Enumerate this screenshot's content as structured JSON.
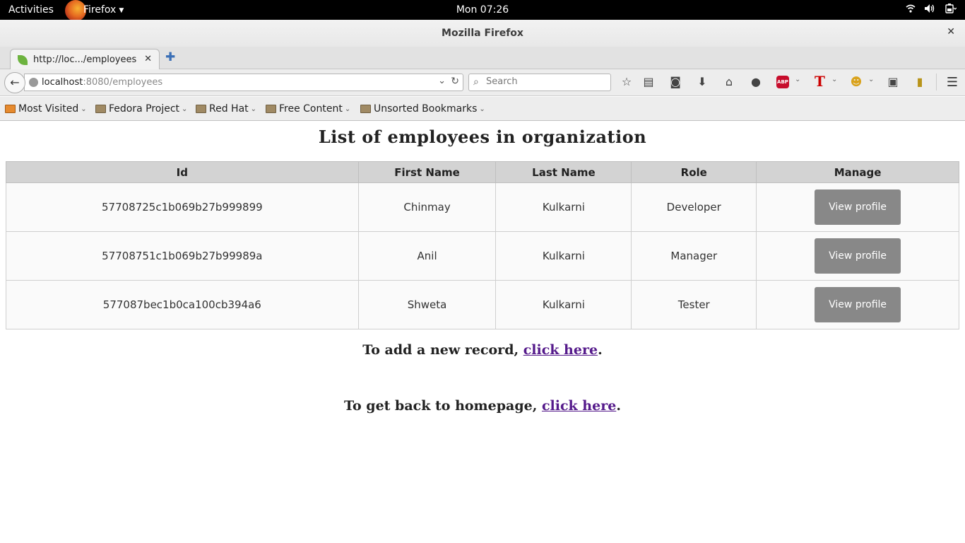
{
  "topbar": {
    "activities": "Activities",
    "app": "Firefox",
    "clock": "Mon 07:26"
  },
  "window": {
    "title": "Mozilla Firefox"
  },
  "tab": {
    "label": "http://loc.../employees"
  },
  "navbar": {
    "url_host": "localhost",
    "url_path": ":8080/employees",
    "search_placeholder": "Search"
  },
  "bookmarks": [
    {
      "label": "Most Visited"
    },
    {
      "label": "Fedora Project"
    },
    {
      "label": "Red Hat"
    },
    {
      "label": "Free Content"
    },
    {
      "label": "Unsorted Bookmarks"
    }
  ],
  "page": {
    "title": "List of employees in organization",
    "columns": [
      "Id",
      "First Name",
      "Last Name",
      "Role",
      "Manage"
    ],
    "rows": [
      {
        "id": "57708725c1b069b27b999899",
        "first": "Chinmay",
        "last": "Kulkarni",
        "role": "Developer",
        "action": "View profile"
      },
      {
        "id": "57708751c1b069b27b99989a",
        "first": "Anil",
        "last": "Kulkarni",
        "role": "Manager",
        "action": "View profile"
      },
      {
        "id": "577087bec1b0ca100cb394a6",
        "first": "Shweta",
        "last": "Kulkarni",
        "role": "Tester",
        "action": "View profile"
      }
    ],
    "add_text": "To add a new record, ",
    "add_link": "click here",
    "home_text": "To get back to homepage, ",
    "home_link": "click here",
    "period": "."
  },
  "colors": {
    "button_bg": "#888888",
    "header_bg": "#d3d3d3",
    "link": "#551a8b"
  }
}
